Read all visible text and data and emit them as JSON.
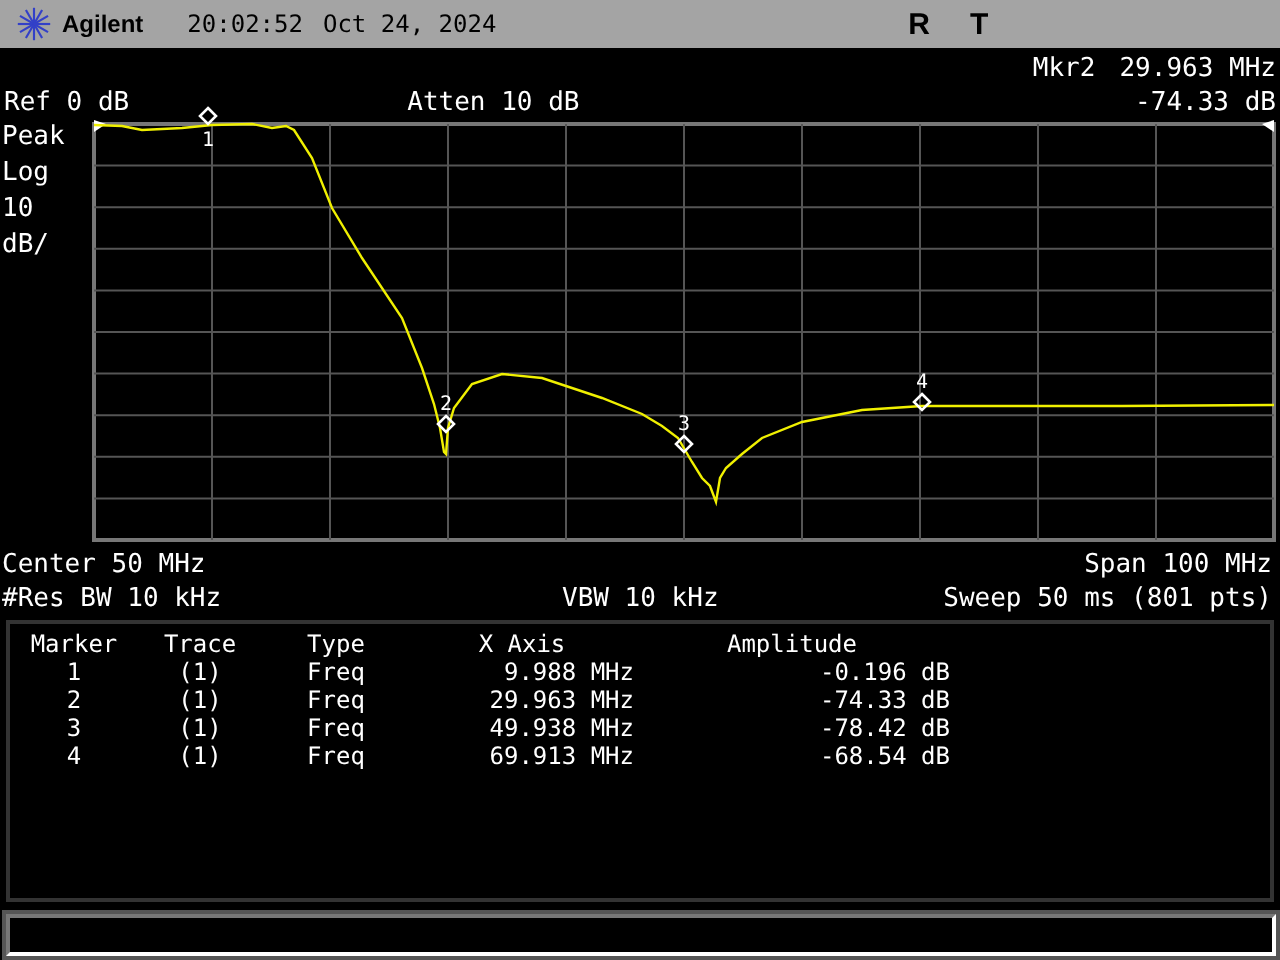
{
  "header": {
    "brand": "Agilent",
    "time": "20:02:52",
    "date": "Oct 24, 2024",
    "indicators": [
      "R",
      "T"
    ]
  },
  "marker_readout": {
    "label": "Mkr2",
    "frequency": "29.963 MHz",
    "amplitude": "-74.33 dB"
  },
  "ref": "Ref 0 dB",
  "atten": "Atten 10 dB",
  "scale_labels": [
    "Peak",
    "Log",
    "10",
    "dB/"
  ],
  "graph_markers": [
    "1",
    "2",
    "3",
    "4"
  ],
  "footer": {
    "center": "Center 50 MHz",
    "span": "Span 100 MHz",
    "res_bw": "#Res BW 10 kHz",
    "vbw": "VBW 10 kHz",
    "sweep": "Sweep 50 ms (801 pts)"
  },
  "marker_table": {
    "columns": [
      "Marker",
      "Trace",
      "Type",
      "X Axis",
      "Amplitude"
    ],
    "rows": [
      [
        "1",
        "(1)",
        "Freq",
        "9.988 MHz",
        "-0.196 dB"
      ],
      [
        "2",
        "(1)",
        "Freq",
        "29.963 MHz",
        "-74.33 dB"
      ],
      [
        "3",
        "(1)",
        "Freq",
        "49.938 MHz",
        "-78.42 dB"
      ],
      [
        "4",
        "(1)",
        "Freq",
        "69.913 MHz",
        "-68.54 dB"
      ]
    ]
  }
}
